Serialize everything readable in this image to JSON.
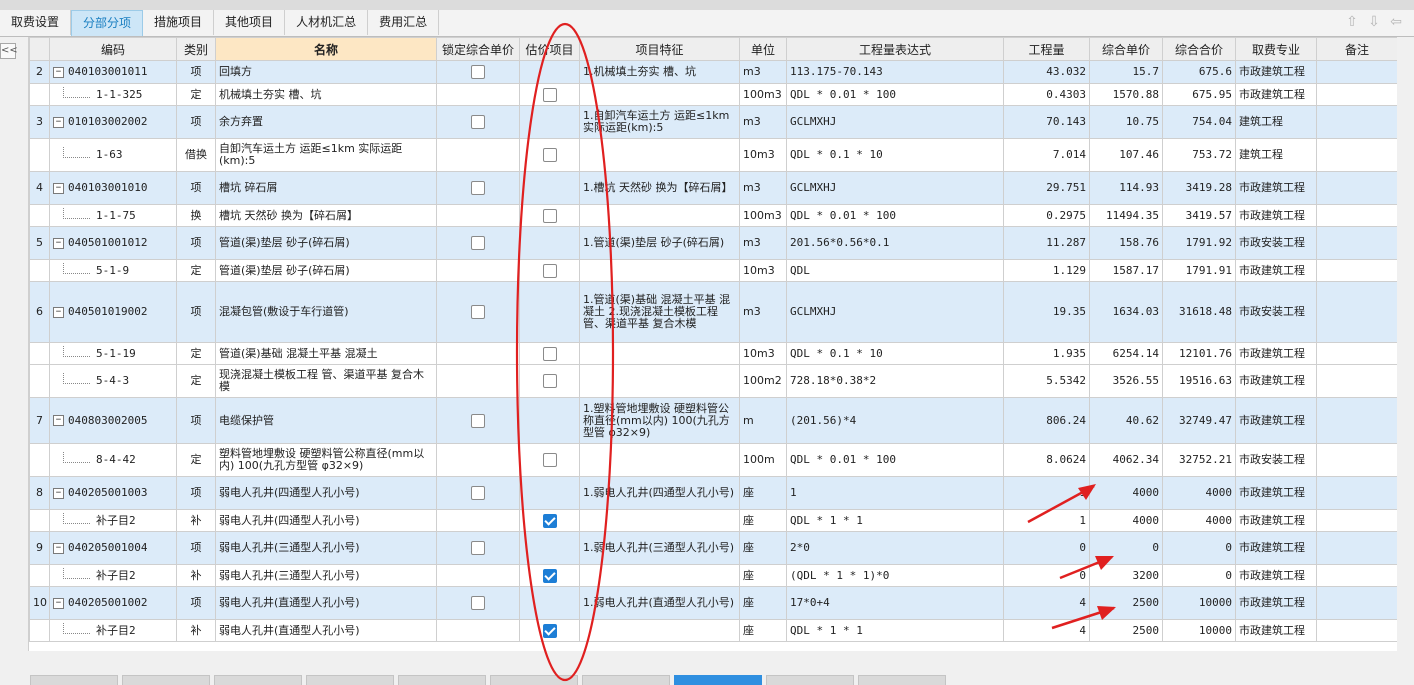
{
  "tabs": [
    {
      "label": "取费设置",
      "active": false
    },
    {
      "label": "分部分项",
      "active": true
    },
    {
      "label": "措施项目",
      "active": false
    },
    {
      "label": "其他项目",
      "active": false
    },
    {
      "label": "人材机汇总",
      "active": false
    },
    {
      "label": "费用汇总",
      "active": false
    }
  ],
  "nav": {
    "up_icon": "arrow-up-icon",
    "down_icon": "arrow-down-icon",
    "back_icon": "arrow-left-icon",
    "collapse_label": "<<"
  },
  "columns": [
    "编码",
    "类别",
    "名称",
    "锁定综合单价",
    "估价项目",
    "项目特征",
    "单位",
    "工程量表达式",
    "工程量",
    "综合单价",
    "综合合价",
    "取费专业",
    "备注"
  ],
  "rows": [
    {
      "kind": "item",
      "no": "2",
      "code": "040103001011",
      "type": "项",
      "name": "回填方",
      "feature": "1.机械填土夯实 槽、坑",
      "unit": "m3",
      "expr": "113.175-70.143",
      "qty": "43.032",
      "price": "15.7",
      "total": "675.6",
      "prof": "市政建筑工程",
      "est": false
    },
    {
      "kind": "sub",
      "no": "",
      "code": "1-1-325",
      "type": "定",
      "name": "机械填土夯实 槽、坑",
      "feature": "",
      "unit": "100m3",
      "expr": "QDL * 0.01 * 100",
      "qty": "0.4303",
      "price": "1570.88",
      "total": "675.95",
      "prof": "市政建筑工程",
      "est": false
    },
    {
      "kind": "item",
      "no": "3",
      "code": "010103002002",
      "type": "项",
      "name": "余方弃置",
      "feature": "1.自卸汽车运土方 运距≤1km 实际运距(km):5",
      "unit": "m3",
      "expr": "GCLMXHJ",
      "qty": "70.143",
      "price": "10.75",
      "total": "754.04",
      "prof": "建筑工程",
      "est": false
    },
    {
      "kind": "sub",
      "no": "",
      "code": "1-63",
      "type": "借换",
      "name": "自卸汽车运土方 运距≤1km 实际运距(km):5",
      "feature": "",
      "unit": "10m3",
      "expr": "QDL * 0.1 * 10",
      "qty": "7.014",
      "price": "107.46",
      "total": "753.72",
      "prof": "建筑工程",
      "est": false
    },
    {
      "kind": "item",
      "no": "4",
      "code": "040103001010",
      "type": "项",
      "name": "槽坑 碎石屑",
      "feature": "1.槽坑 天然砂 换为【碎石屑】",
      "unit": "m3",
      "expr": "GCLMXHJ",
      "qty": "29.751",
      "price": "114.93",
      "total": "3419.28",
      "prof": "市政建筑工程",
      "est": false
    },
    {
      "kind": "sub",
      "no": "",
      "code": "1-1-75",
      "type": "换",
      "name": "槽坑 天然砂 换为【碎石屑】",
      "feature": "",
      "unit": "100m3",
      "expr": "QDL * 0.01 * 100",
      "qty": "0.2975",
      "price": "11494.35",
      "total": "3419.57",
      "prof": "市政建筑工程",
      "est": false
    },
    {
      "kind": "item",
      "no": "5",
      "code": "040501001012",
      "type": "项",
      "name": "管道(渠)垫层 砂子(碎石屑)",
      "feature": "1.管道(渠)垫层 砂子(碎石屑)",
      "unit": "m3",
      "expr": "201.56*0.56*0.1",
      "qty": "11.287",
      "price": "158.76",
      "total": "1791.92",
      "prof": "市政安装工程",
      "est": false
    },
    {
      "kind": "sub",
      "no": "",
      "code": "5-1-9",
      "type": "定",
      "name": "管道(渠)垫层 砂子(碎石屑)",
      "feature": "",
      "unit": "10m3",
      "expr": "QDL",
      "qty": "1.129",
      "price": "1587.17",
      "total": "1791.91",
      "prof": "市政建筑工程",
      "est": false
    },
    {
      "kind": "item",
      "no": "6",
      "code": "040501019002",
      "type": "项",
      "name": "混凝包管(敷设于车行道管)",
      "feature": "1.管道(渠)基础 混凝土平基 混凝土 2.现浇混凝土模板工程 管、渠道平基 复合木模",
      "unit": "m3",
      "expr": "GCLMXHJ",
      "qty": "19.35",
      "price": "1634.03",
      "total": "31618.48",
      "prof": "市政安装工程",
      "est": false
    },
    {
      "kind": "sub",
      "no": "",
      "code": "5-1-19",
      "type": "定",
      "name": "管道(渠)基础 混凝土平基 混凝土",
      "feature": "",
      "unit": "10m3",
      "expr": "QDL * 0.1 * 10",
      "qty": "1.935",
      "price": "6254.14",
      "total": "12101.76",
      "prof": "市政建筑工程",
      "est": false
    },
    {
      "kind": "sub",
      "no": "",
      "code": "5-4-3",
      "type": "定",
      "name": "现浇混凝土模板工程 管、渠道平基 复合木模",
      "feature": "",
      "unit": "100m2",
      "expr": "728.18*0.38*2",
      "qty": "5.5342",
      "price": "3526.55",
      "total": "19516.63",
      "prof": "市政建筑工程",
      "est": false
    },
    {
      "kind": "item",
      "no": "7",
      "code": "040803002005",
      "type": "项",
      "name": "电缆保护管",
      "feature": "1.塑料管地埋敷设 硬塑料管公称直径(mm以内) 100(九孔方型管 φ32×9)",
      "unit": "m",
      "expr": "(201.56)*4",
      "qty": "806.24",
      "price": "40.62",
      "total": "32749.47",
      "prof": "市政建筑工程",
      "est": false
    },
    {
      "kind": "sub",
      "no": "",
      "code": "8-4-42",
      "type": "定",
      "name": "塑料管地埋敷设 硬塑料管公称直径(mm以内) 100(九孔方型管 φ32×9)",
      "feature": "",
      "unit": "100m",
      "expr": "QDL * 0.01 * 100",
      "qty": "8.0624",
      "price": "4062.34",
      "total": "32752.21",
      "prof": "市政安装工程",
      "est": false
    },
    {
      "kind": "item",
      "no": "8",
      "code": "040205001003",
      "type": "项",
      "name": "弱电人孔井(四通型人孔小号)",
      "feature": "1.弱电人孔井(四通型人孔小号)",
      "unit": "座",
      "expr": "1",
      "qty": "1",
      "price": "4000",
      "total": "4000",
      "prof": "市政建筑工程",
      "est": false
    },
    {
      "kind": "sub",
      "no": "",
      "code": "补子目2",
      "type": "补",
      "name": "弱电人孔井(四通型人孔小号)",
      "feature": "",
      "unit": "座",
      "expr": "QDL * 1 * 1",
      "qty": "1",
      "price": "4000",
      "total": "4000",
      "prof": "市政建筑工程",
      "est": true
    },
    {
      "kind": "item",
      "no": "9",
      "code": "040205001004",
      "type": "项",
      "name": "弱电人孔井(三通型人孔小号)",
      "feature": "1.弱电人孔井(三通型人孔小号)",
      "unit": "座",
      "expr": "2*0",
      "qty": "0",
      "price": "0",
      "total": "0",
      "prof": "市政建筑工程",
      "est": false
    },
    {
      "kind": "sub",
      "no": "",
      "code": "补子目2",
      "type": "补",
      "name": "弱电人孔井(三通型人孔小号)",
      "feature": "",
      "unit": "座",
      "expr": "(QDL * 1 * 1)*0",
      "qty": "0",
      "price": "3200",
      "total": "0",
      "prof": "市政建筑工程",
      "est": true
    },
    {
      "kind": "item",
      "no": "10",
      "code": "040205001002",
      "type": "项",
      "name": "弱电人孔井(直通型人孔小号)",
      "feature": "1.弱电人孔井(直通型人孔小号)",
      "unit": "座",
      "expr": "17*0+4",
      "qty": "4",
      "price": "2500",
      "total": "10000",
      "prof": "市政建筑工程",
      "est": false
    },
    {
      "kind": "sub",
      "no": "",
      "code": "补子目2",
      "type": "补",
      "name": "弱电人孔井(直通型人孔小号)",
      "feature": "",
      "unit": "座",
      "expr": "QDL * 1 * 1",
      "qty": "4",
      "price": "2500",
      "total": "10000",
      "prof": "市政建筑工程",
      "est": true
    }
  ],
  "row_heights": [
    23,
    22,
    33,
    33,
    33,
    22,
    33,
    22,
    61,
    22,
    33,
    46,
    33,
    33,
    22,
    33,
    22,
    33,
    22
  ],
  "annotation_color": "#e02020"
}
